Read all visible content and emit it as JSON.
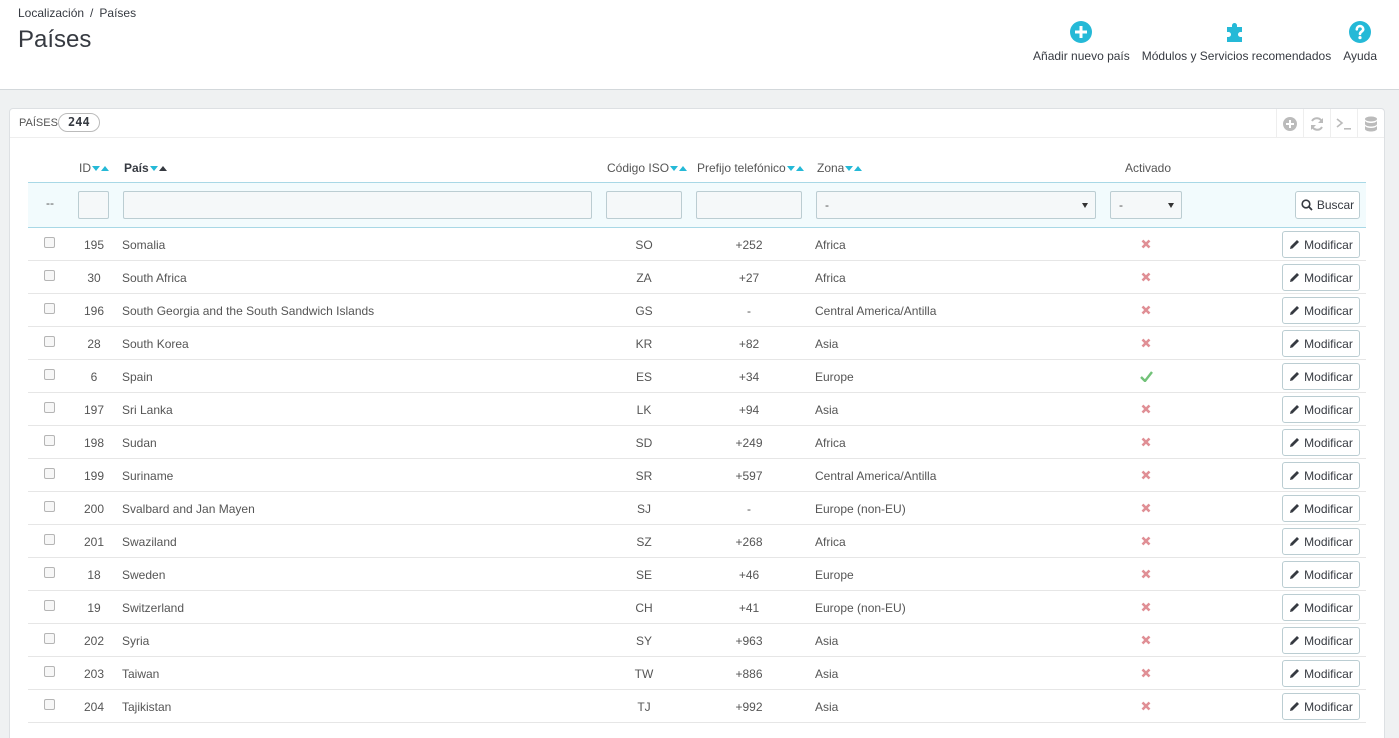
{
  "breadcrumb": {
    "parent": "Localización",
    "separator": "/",
    "current": "Países"
  },
  "page_title": "Países",
  "toolbar": {
    "add": "Añadir nuevo país",
    "modules": "Módulos y Servicios recomendados",
    "help": "Ayuda"
  },
  "panel": {
    "title": "Países",
    "count": "244"
  },
  "columns": {
    "id": "ID",
    "name": "País",
    "iso": "Código ISO",
    "prefix": "Prefijo telefónico",
    "zone": "Zona",
    "active": "Activado"
  },
  "filters": {
    "placeholder_dash": "--",
    "zone_selected": "-",
    "active_selected": "-",
    "search_label": "Buscar"
  },
  "edit_label": "Modificar",
  "colors": {
    "accent": "#25b9d7",
    "enabled": "#72c279",
    "disabled": "#e08f95"
  },
  "rows": [
    {
      "id": "195",
      "name": "Somalia",
      "iso": "SO",
      "prefix": "+252",
      "zone": "Africa",
      "active": false
    },
    {
      "id": "30",
      "name": "South Africa",
      "iso": "ZA",
      "prefix": "+27",
      "zone": "Africa",
      "active": false
    },
    {
      "id": "196",
      "name": "South Georgia and the South Sandwich Islands",
      "iso": "GS",
      "prefix": "-",
      "zone": "Central America/Antilla",
      "active": false
    },
    {
      "id": "28",
      "name": "South Korea",
      "iso": "KR",
      "prefix": "+82",
      "zone": "Asia",
      "active": false
    },
    {
      "id": "6",
      "name": "Spain",
      "iso": "ES",
      "prefix": "+34",
      "zone": "Europe",
      "active": true
    },
    {
      "id": "197",
      "name": "Sri Lanka",
      "iso": "LK",
      "prefix": "+94",
      "zone": "Asia",
      "active": false
    },
    {
      "id": "198",
      "name": "Sudan",
      "iso": "SD",
      "prefix": "+249",
      "zone": "Africa",
      "active": false
    },
    {
      "id": "199",
      "name": "Suriname",
      "iso": "SR",
      "prefix": "+597",
      "zone": "Central America/Antilla",
      "active": false
    },
    {
      "id": "200",
      "name": "Svalbard and Jan Mayen",
      "iso": "SJ",
      "prefix": "-",
      "zone": "Europe (non-EU)",
      "active": false
    },
    {
      "id": "201",
      "name": "Swaziland",
      "iso": "SZ",
      "prefix": "+268",
      "zone": "Africa",
      "active": false
    },
    {
      "id": "18",
      "name": "Sweden",
      "iso": "SE",
      "prefix": "+46",
      "zone": "Europe",
      "active": false
    },
    {
      "id": "19",
      "name": "Switzerland",
      "iso": "CH",
      "prefix": "+41",
      "zone": "Europe (non-EU)",
      "active": false
    },
    {
      "id": "202",
      "name": "Syria",
      "iso": "SY",
      "prefix": "+963",
      "zone": "Asia",
      "active": false
    },
    {
      "id": "203",
      "name": "Taiwan",
      "iso": "TW",
      "prefix": "+886",
      "zone": "Asia",
      "active": false
    },
    {
      "id": "204",
      "name": "Tajikistan",
      "iso": "TJ",
      "prefix": "+992",
      "zone": "Asia",
      "active": false
    }
  ]
}
